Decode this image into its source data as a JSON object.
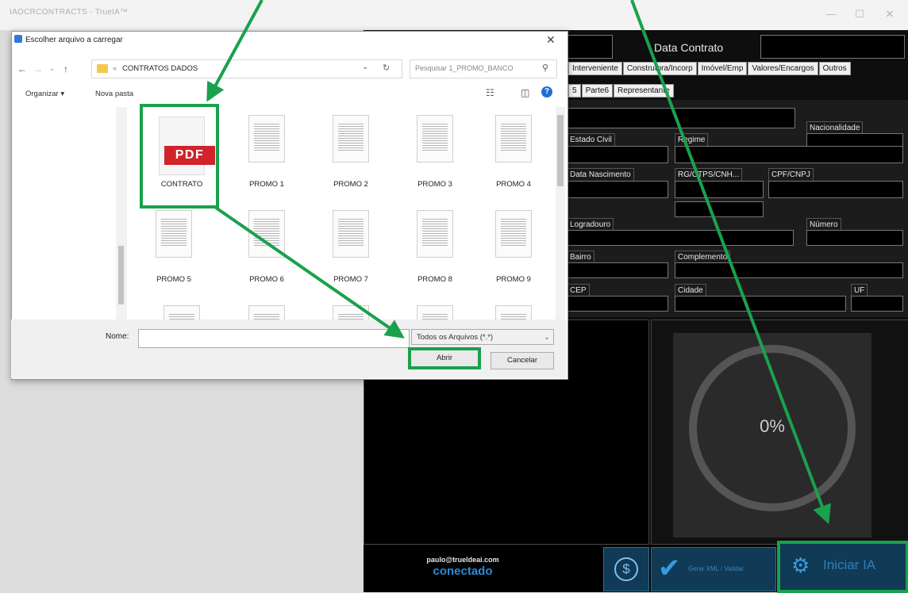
{
  "app": {
    "title": "IAOCRCONTRACTS - TrueIA™",
    "window_buttons": [
      "—",
      "☐",
      "✕"
    ],
    "contract_date_label": "Data Contrato",
    "tabs_row1": [
      "Interveniente",
      "Construtora/Incorp",
      "Imóvel/Emp",
      "Valores/Encargos",
      "Outros"
    ],
    "tabs_row2": [
      "5",
      "Parte6",
      "Representante"
    ],
    "fields": {
      "nacionalidade": "Nacionalidade",
      "estado_civil": "Estado Civil",
      "regime": "Regime",
      "data_nascimento": "Data Nascimento",
      "rg": "RG/CTPS/CNH...",
      "cpf": "CPF/CNPJ",
      "logradouro": "Logradouro",
      "numero": "Número",
      "bairro": "Bairro",
      "complemento": "Complemento",
      "cep": "CEP",
      "cidade": "Cidade",
      "uf": "UF"
    },
    "progress": {
      "value": 0,
      "label": "0%"
    },
    "status": {
      "email": "paulo@trueldeai.com",
      "connection": "conectado"
    },
    "buttons": {
      "generate": "Gerar XML / Validar",
      "start_ai": "Iniciar IA"
    },
    "colors": {
      "highlight": "#1aa14e",
      "accent_blue": "#2a8bd8",
      "pdf_red": "#d0232a"
    }
  },
  "dialog": {
    "title": "Escolher arquivo a carregar",
    "breadcrumb_prefix": "«",
    "breadcrumb": "CONTRATOS DADOS",
    "search_placeholder": "Pesquisar 1_PROMO_BANCO",
    "toolbar": {
      "organize": "Organizar ▾",
      "new_folder": "Nova pasta"
    },
    "files": [
      "CONTRATO",
      "PROMO 1",
      "PROMO 2",
      "PROMO 3",
      "PROMO 4",
      "PROMO 5",
      "PROMO 6",
      "PROMO 7",
      "PROMO 8",
      "PROMO 9"
    ],
    "pdf_label": "PDF",
    "name_label": "Nome:",
    "name_value": "",
    "file_type": "Todos os Arquivos (*.*)",
    "open_button": "Abrir",
    "cancel_button": "Cancelar"
  }
}
